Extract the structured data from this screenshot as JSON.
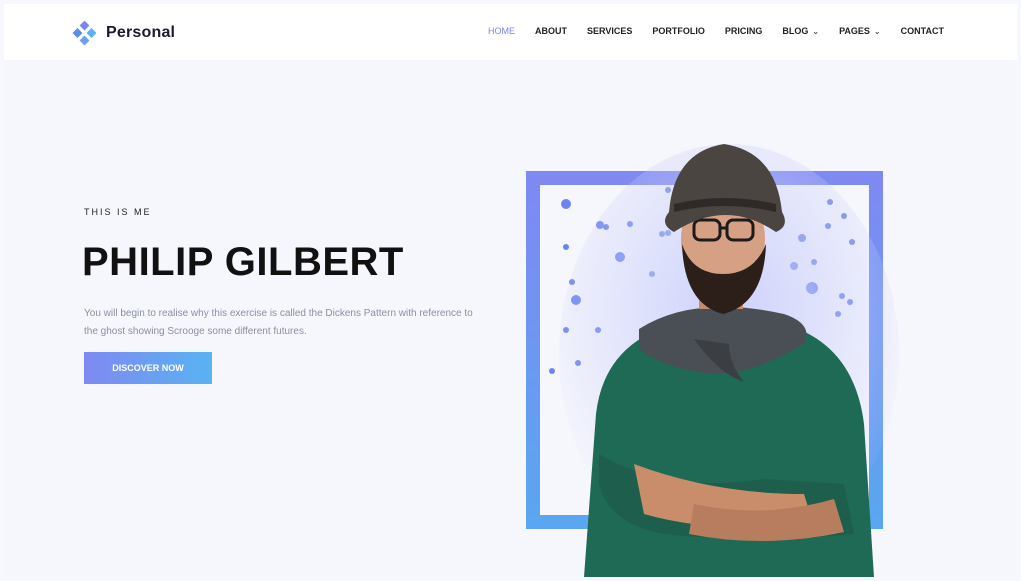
{
  "brand": {
    "name": "Personal",
    "icon": "diamond-cluster-icon",
    "color": "#5b8def"
  },
  "nav": {
    "items": [
      {
        "label": "HOME",
        "active": true
      },
      {
        "label": "ABOUT"
      },
      {
        "label": "SERVICES"
      },
      {
        "label": "PORTFOLIO"
      },
      {
        "label": "PRICING"
      },
      {
        "label": "BLOG",
        "dropdown": true
      },
      {
        "label": "PAGES",
        "dropdown": true
      },
      {
        "label": "CONTACT"
      }
    ],
    "dropdown_icon": "chevron-down-icon",
    "active_color": "#7b86f0"
  },
  "hero": {
    "eyebrow": "THIS IS ME",
    "name": "PHILIP GILBERT",
    "description": "You will begin to realise why this exercise is called the Dickens Pattern with reference to the ghost showing Scrooge some different futures.",
    "cta_label": "DISCOVER NOW",
    "accent_gradient": [
      "#7f89f2",
      "#58b3f2"
    ]
  }
}
